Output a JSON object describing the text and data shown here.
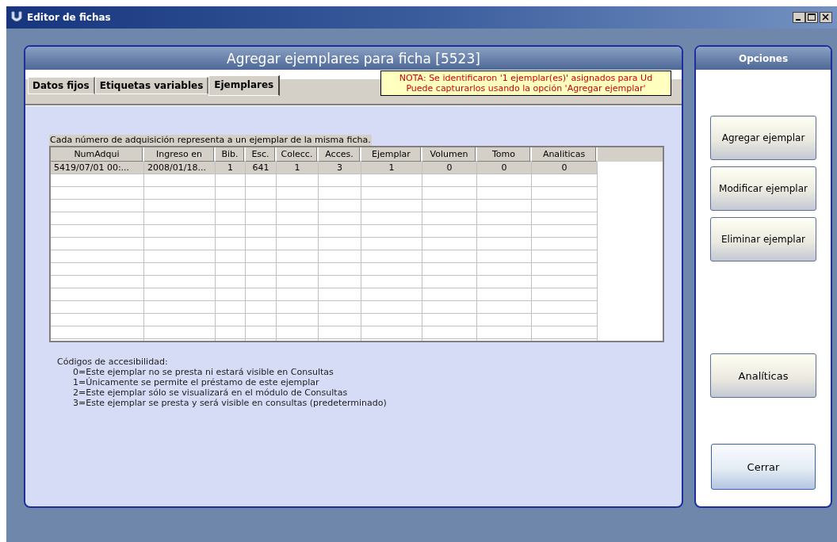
{
  "window": {
    "title": "Editor de fichas"
  },
  "panel": {
    "title": "Agregar ejemplares para ficha [5523]"
  },
  "tabs": [
    {
      "label": "Datos fijos",
      "selected": false
    },
    {
      "label": "Etiquetas variables",
      "selected": false
    },
    {
      "label": "Ejemplares",
      "selected": true
    }
  ],
  "note": {
    "lines": [
      "NOTA: Se identificaron '1 ejemplar(es)' asignados para Ud",
      "Puede capturarlos usando la opción 'Agregar ejemplar'"
    ]
  },
  "table": {
    "caption": "Cada número de adquisición representa a un ejemplar de la misma ficha.",
    "columns": [
      "NumAdqui",
      "Ingreso en",
      "Bib.",
      "Esc.",
      "Colecc.",
      "Acces.",
      "Ejemplar",
      "Volumen",
      "Tomo",
      "Analiticas"
    ],
    "rows": [
      {
        "selected": true,
        "cells": [
          "5419/07/01 00:...",
          "2008/01/18...",
          "1",
          "641",
          "1",
          "3",
          "1",
          "0",
          "0",
          "0"
        ]
      }
    ]
  },
  "legend": {
    "title": "Códigos de accesibilidad:",
    "items": [
      "0=Este ejemplar no se presta ni estará visible en Consultas",
      "1=Únicamente se permite el préstamo de este ejemplar",
      "2=Este ejemplar sólo se visualizará en el módulo de Consultas",
      "3=Este ejemplar se presta y será visible en consultas (predeterminado)"
    ]
  },
  "options": {
    "title": "Opciones",
    "buttons": [
      {
        "label": "Agregar ejemplar",
        "kind": "action"
      },
      {
        "label": "Modificar ejemplar",
        "kind": "action"
      },
      {
        "label": "Eliminar ejemplar",
        "kind": "action"
      },
      {
        "label": "Analíticas",
        "kind": "analytics"
      },
      {
        "label": "Cerrar",
        "kind": "close"
      }
    ]
  }
}
